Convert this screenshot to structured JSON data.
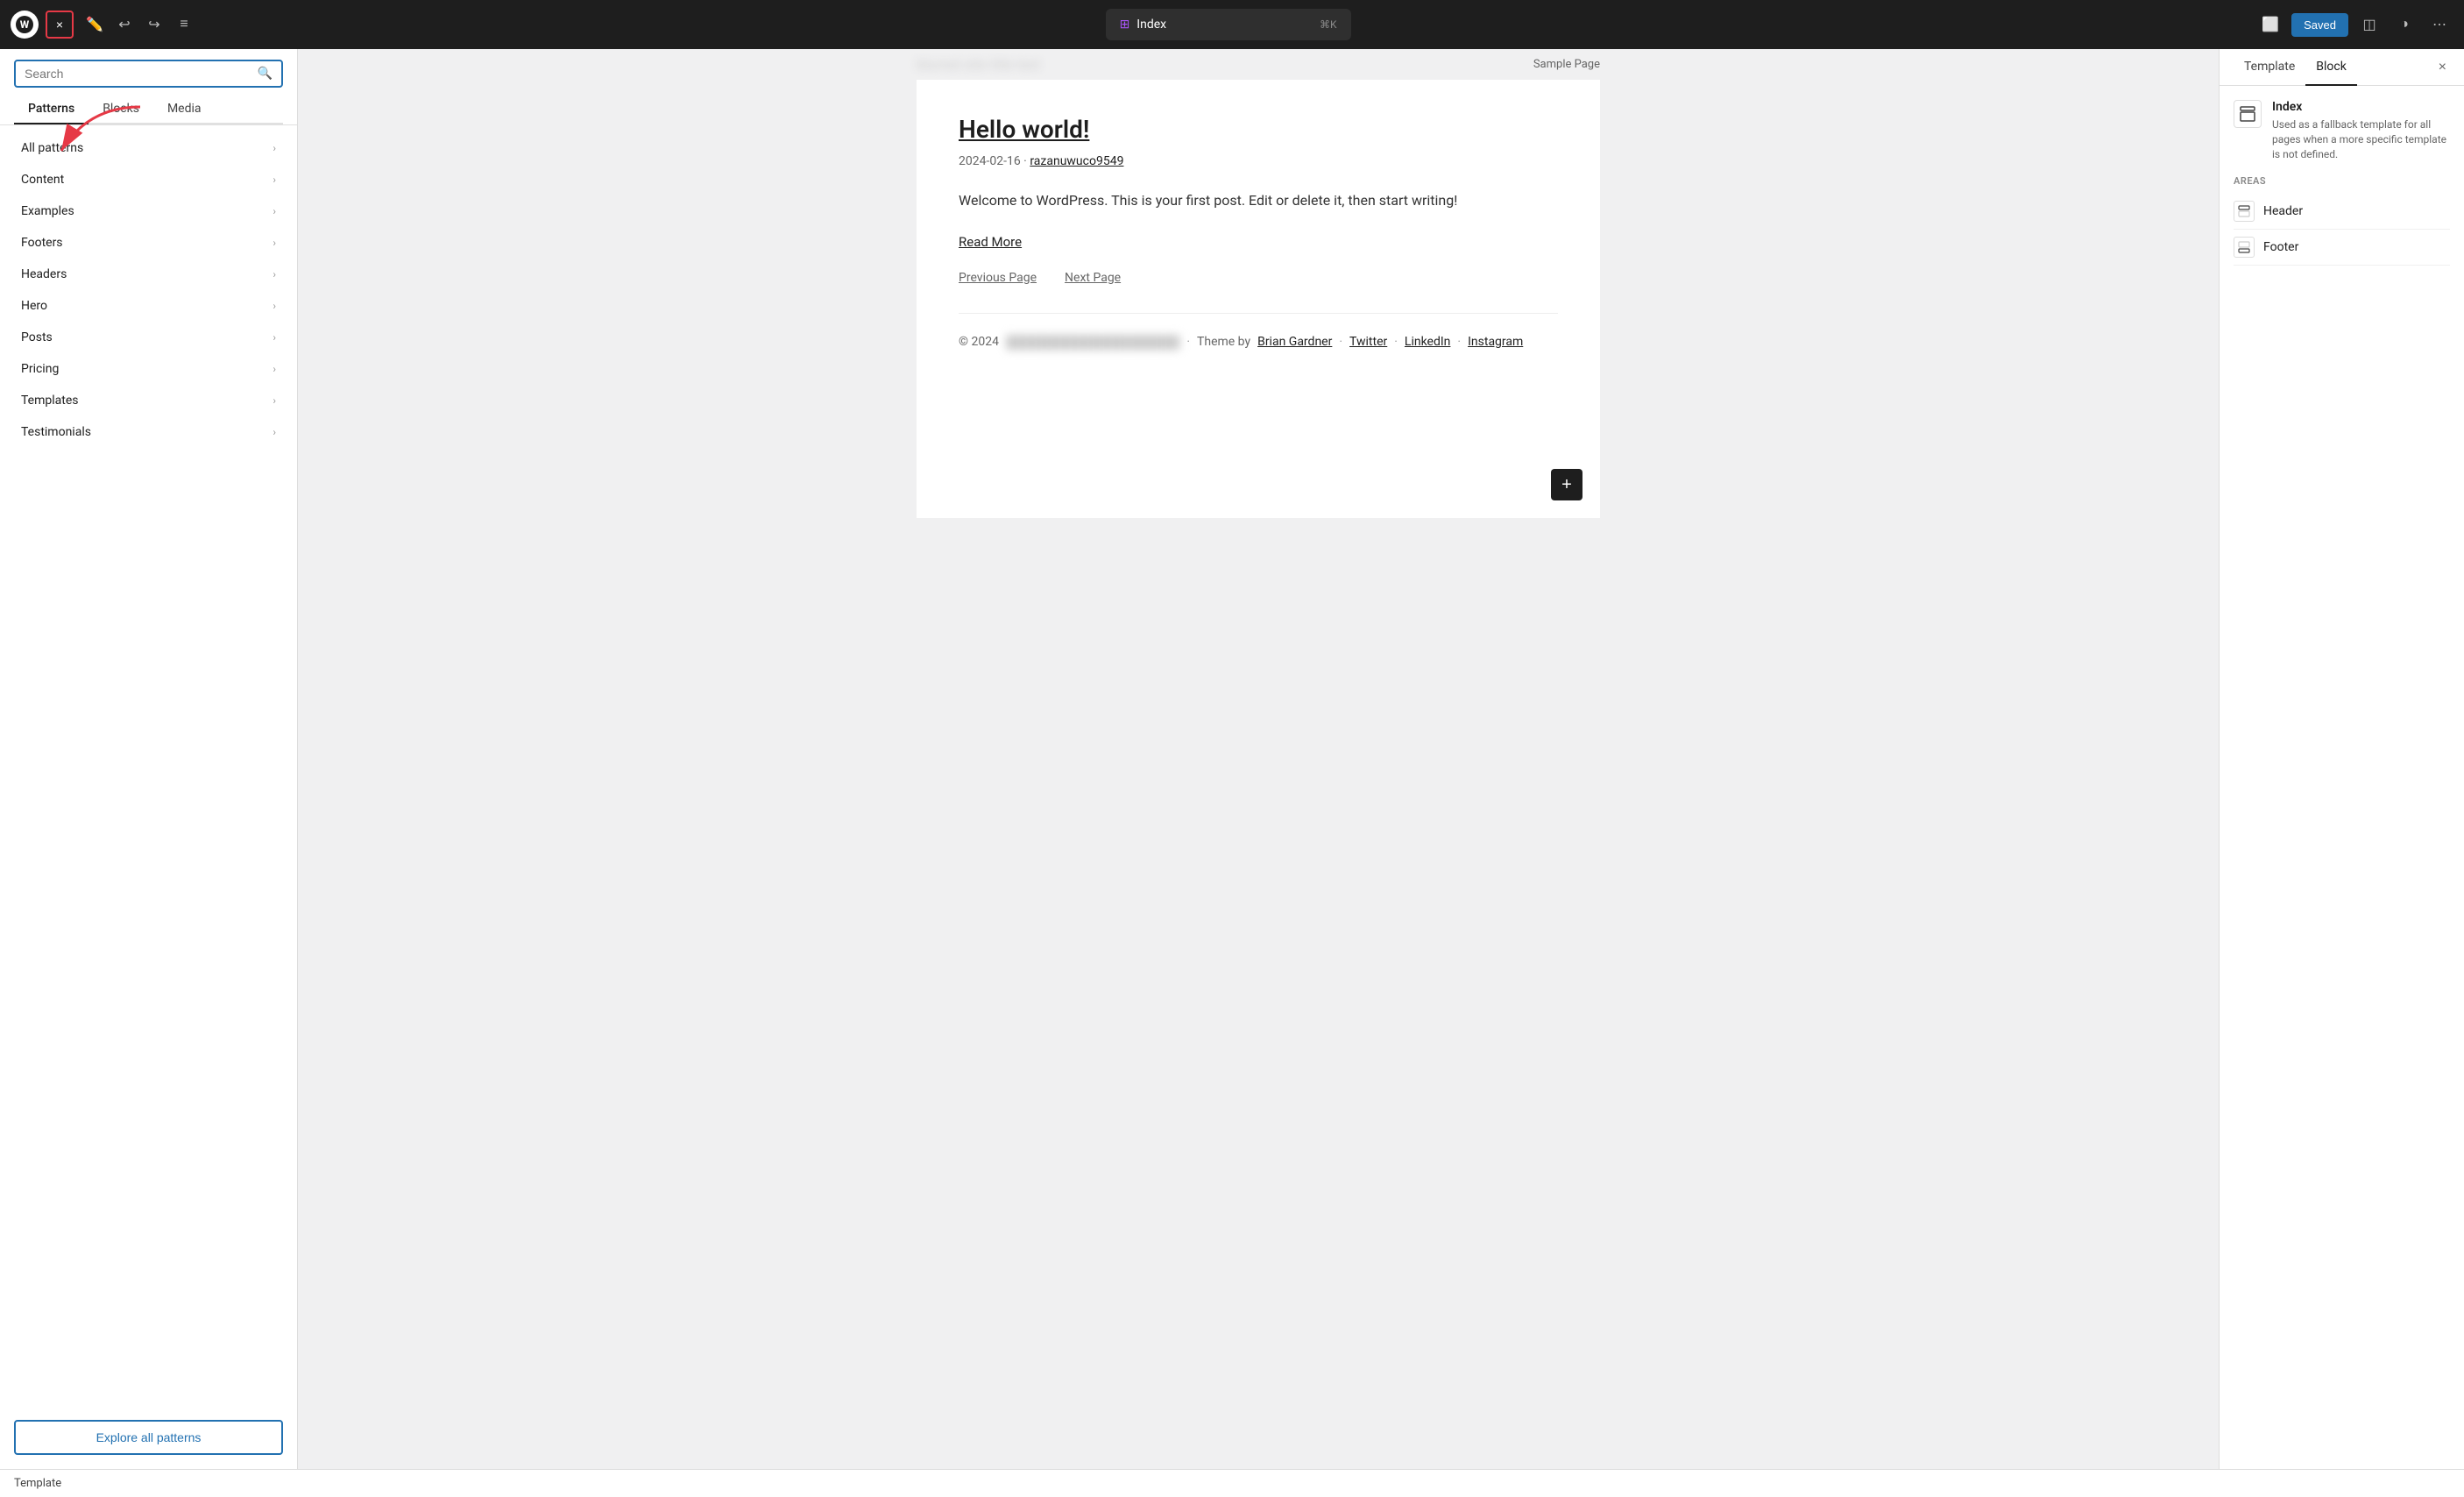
{
  "topbar": {
    "close_label": "×",
    "undo_icon": "↩",
    "redo_icon": "↪",
    "list_icon": "≡",
    "command_icon": "⊞",
    "command_text": "Index",
    "command_shortcut": "⌘K",
    "saved_label": "Saved",
    "layout_icon": "⬜",
    "split_icon": "◫",
    "contrast_icon": "◑",
    "more_icon": "⋯"
  },
  "left_panel": {
    "search_placeholder": "Search",
    "tabs": [
      "Patterns",
      "Blocks",
      "Media"
    ],
    "active_tab": "Patterns",
    "items": [
      {
        "label": "All patterns"
      },
      {
        "label": "Content"
      },
      {
        "label": "Examples"
      },
      {
        "label": "Footers"
      },
      {
        "label": "Headers"
      },
      {
        "label": "Hero"
      },
      {
        "label": "Posts"
      },
      {
        "label": "Pricing"
      },
      {
        "label": "Templates"
      },
      {
        "label": "Testimonials"
      }
    ],
    "explore_label": "Explore all patterns"
  },
  "canvas": {
    "blurred_header": "blurred site title text",
    "sample_page_label": "Sample Page",
    "post_title": "Hello world!",
    "post_meta_date": "2024-02-16",
    "post_meta_author": "razanuwuco9549",
    "post_body": "Welcome to WordPress. This is your first post. Edit or delete it, then start writing!",
    "read_more": "Read More",
    "prev_page": "Previous Page",
    "next_page": "Next Page",
    "footer_year": "© 2024",
    "footer_blurred": "blurred site name",
    "footer_theme_label": "Theme by",
    "footer_theme_author": "Brian Gardner",
    "footer_links": [
      "Twitter",
      "LinkedIn",
      "Instagram"
    ],
    "add_block": "+"
  },
  "right_panel": {
    "tabs": [
      "Template",
      "Block"
    ],
    "active_tab": "Block",
    "close_icon": "×",
    "template_name": "Index",
    "template_description": "Used as a fallback template for all pages when a more specific template is not defined.",
    "areas_label": "AREAS",
    "areas": [
      "Header",
      "Footer"
    ]
  },
  "footer_bar": {
    "label": "Template"
  }
}
